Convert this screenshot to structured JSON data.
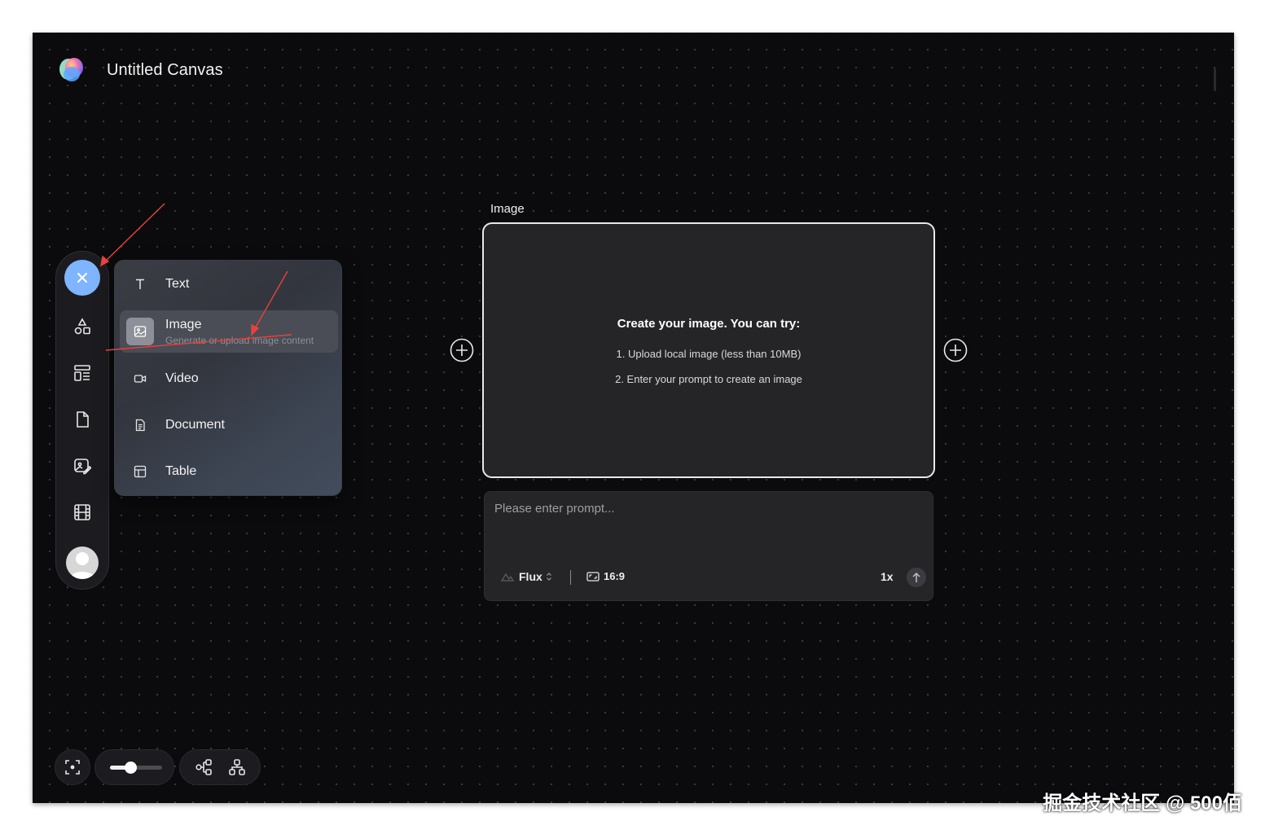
{
  "header": {
    "title": "Untitled Canvas"
  },
  "toolbar": {
    "items": [
      {
        "icon": "close-icon"
      },
      {
        "icon": "shapes-icon"
      },
      {
        "icon": "layout-template-icon"
      },
      {
        "icon": "file-icon"
      },
      {
        "icon": "image-edit-icon"
      },
      {
        "icon": "film-icon"
      },
      {
        "icon": "user-avatar"
      }
    ],
    "accent": "#7fb5ff"
  },
  "menu": {
    "items": [
      {
        "label": "Text",
        "icon": "text-icon"
      },
      {
        "label": "Image",
        "icon": "image-icon",
        "description": "Generate or upload image content",
        "active": true
      },
      {
        "label": "Video",
        "icon": "video-icon"
      },
      {
        "label": "Document",
        "icon": "document-icon"
      },
      {
        "label": "Table",
        "icon": "table-icon"
      }
    ]
  },
  "node": {
    "label": "Image",
    "heading": "Create your image. You can try:",
    "tips": [
      "1. Upload local image (less than 10MB)",
      "2. Enter your prompt to create an image"
    ]
  },
  "prompt": {
    "placeholder": "Please enter prompt...",
    "model": "Flux",
    "ratio": "16:9",
    "count": "1x"
  },
  "bottom_controls": {
    "zoom_level": 0.4
  },
  "watermark": "掘金技术社区 @ 500佰"
}
